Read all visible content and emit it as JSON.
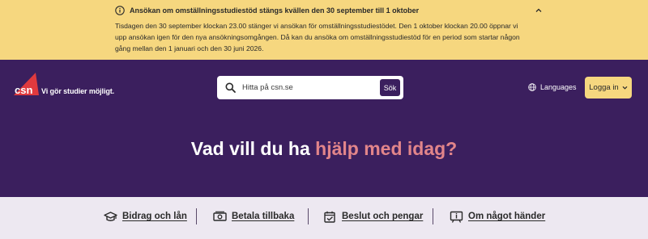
{
  "notice": {
    "title": "Ansökan om omställningsstudiestöd stängs kvällen den 30 september till 1 oktober",
    "body_lines": [
      "Tisdagen den 30 september klockan 23.00 stänger vi ansökan för omställningsstudiestödet. Den 1 oktober klockan 20.00 öppnar vi",
      "upp ansökan igen för den nya ansökningsomgången. Då kan du ansöka om omställningsstudiestöd för en period som startar någon",
      "gång mellan den 1 januari och den 30 juni 2026."
    ]
  },
  "header": {
    "logo_text": "csn",
    "tagline": "Vi gör studier möjligt.",
    "search": {
      "placeholder": "Hitta på csn.se",
      "button_label": "Sök"
    },
    "languages_label": "Languages",
    "login_label": "Logga in"
  },
  "hero": {
    "headline_plain": "Vad vill du ha ",
    "headline_accent": "hjälp med idag?"
  },
  "quicklinks": [
    {
      "label": "Bidrag och lån",
      "icon": "graduation-cap-icon"
    },
    {
      "label": "Betala tillbaka",
      "icon": "money-icon"
    },
    {
      "label": "Beslut och pengar",
      "icon": "calendar-check-icon"
    },
    {
      "label": "Om något händer",
      "icon": "info-board-icon"
    }
  ],
  "colors": {
    "brand_purple": "#3b1f5e",
    "notice_yellow": "#f6d77f",
    "accent_pink": "#e2858a",
    "logo_red": "#e03a3e",
    "quicklinks_bg": "#ede8f1"
  }
}
